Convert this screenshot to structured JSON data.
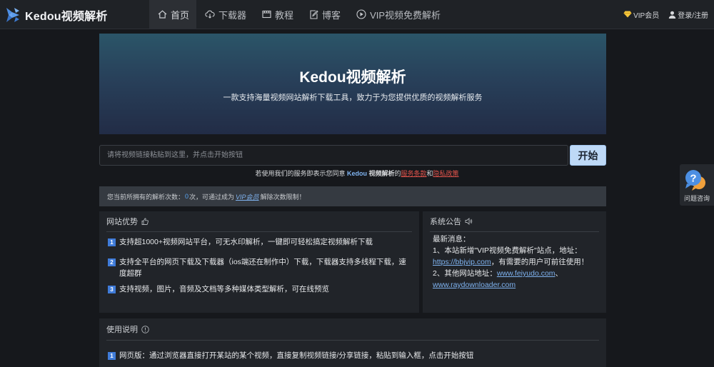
{
  "brand": {
    "name": "Kedou视频解析",
    "accent": "#3f7bd9"
  },
  "nav": [
    {
      "label": "首页",
      "icon": "home-icon",
      "active": true
    },
    {
      "label": "下载器",
      "icon": "cloud-download-icon",
      "active": false
    },
    {
      "label": "教程",
      "icon": "video-icon",
      "active": false
    },
    {
      "label": "博客",
      "icon": "edit-icon",
      "active": false
    },
    {
      "label": "VIP视频免费解析",
      "icon": "play-circle-icon",
      "active": false
    }
  ],
  "header_right": {
    "vip": "VIP会员",
    "login": "登录/注册"
  },
  "hero": {
    "title": "Kedou视频解析",
    "subtitle": "一款支持海量视频网站解析下载工具，致力于为您提供优质的视频解析服务"
  },
  "search": {
    "placeholder": "请将视频链接粘贴到这里，并点击开始按钮",
    "button": "开始"
  },
  "agreement": {
    "prefix": "若使用我们的服务即表示您同意",
    "brand": "Kedou",
    "brand_suffix": "视频解析",
    "de": "的",
    "terms": "服务条款",
    "and": "和",
    "privacy": "隐私政策"
  },
  "quota": {
    "prefix": "您当前所拥有的解析次数：",
    "count": "0",
    "middle": "次，可通过成为",
    "link": "VIP会员",
    "suffix": "解除次数限制！"
  },
  "advantages": {
    "title": "网站优势",
    "items": [
      {
        "num": "1",
        "text": "支持超1000+视频网站平台，可无水印解析，一键即可轻松搞定视频解析下载"
      },
      {
        "num": "2",
        "text": "支持全平台的网页下载及下载器（ios端还在制作中）下载，下载器支持多线程下载，速度超群"
      },
      {
        "num": "3",
        "text": "支持视频，图片，音频及文档等多种媒体类型解析，可在线预览"
      }
    ]
  },
  "announcement": {
    "title": "系统公告",
    "heading": "最新消息：",
    "line1_text": "1、本站新增\"VIP视频免费解析\"站点，地址：",
    "line1_link": "https://bbjvip.com",
    "line1_suffix": "，有需要的用户可前往使用！",
    "line2_text": "2、其他网站地址：",
    "line2_link1": "www.feiyudo.com",
    "line2_sep": "、",
    "line2_link2": "www.raydownloader.com"
  },
  "usage": {
    "title": "使用说明",
    "items": [
      {
        "num": "1",
        "text": "网页版：通过浏览器直接打开某站的某个视频，直接复制视频链接/分享链接，粘贴到输入框，点击开始按钮"
      }
    ]
  },
  "help": {
    "label": "问题咨询"
  }
}
